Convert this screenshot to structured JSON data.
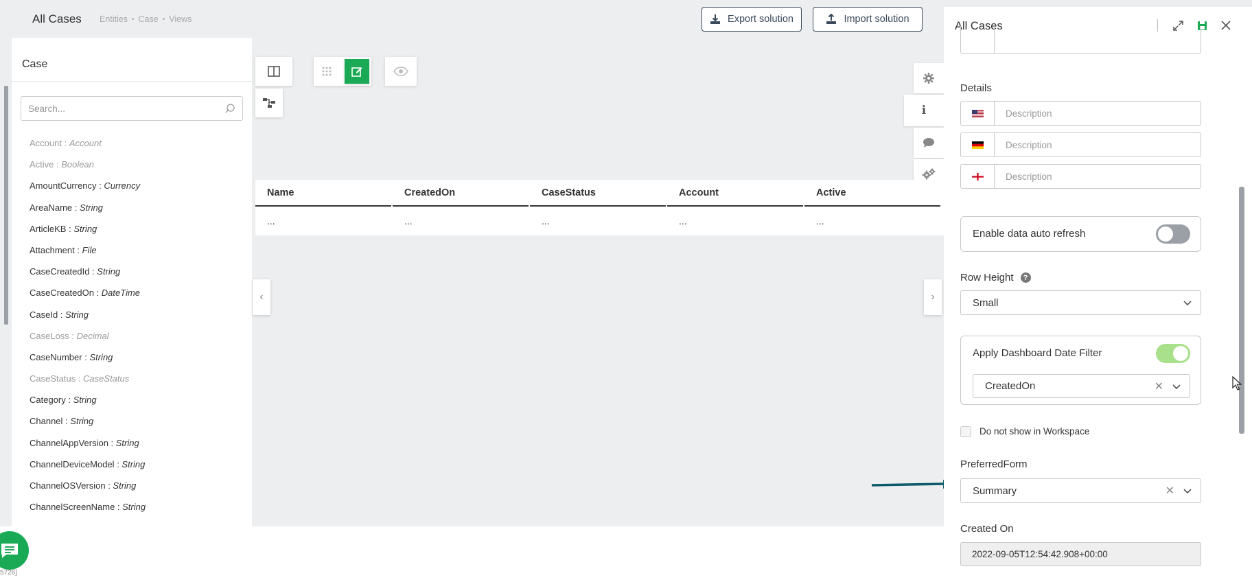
{
  "header": {
    "title": "All Cases",
    "breadcrumb": [
      "Entities",
      "Case",
      "Views"
    ],
    "export_label": "Export solution",
    "import_label": "Import solution"
  },
  "left_panel": {
    "title": "Case",
    "search_placeholder": "Search...",
    "fields": [
      {
        "name": "Account",
        "type": "Account",
        "muted": true
      },
      {
        "name": "Active",
        "type": "Boolean",
        "muted": true
      },
      {
        "name": "AmountCurrency",
        "type": "Currency",
        "muted": false
      },
      {
        "name": "AreaName",
        "type": "String",
        "muted": false
      },
      {
        "name": "ArticleKB",
        "type": "String",
        "muted": false
      },
      {
        "name": "Attachment",
        "type": "File",
        "muted": false
      },
      {
        "name": "CaseCreatedId",
        "type": "String",
        "muted": false
      },
      {
        "name": "CaseCreatedOn",
        "type": "DateTime",
        "muted": false
      },
      {
        "name": "CaseId",
        "type": "String",
        "muted": false
      },
      {
        "name": "CaseLoss",
        "type": "Decimal",
        "muted": true
      },
      {
        "name": "CaseNumber",
        "type": "String",
        "muted": false
      },
      {
        "name": "CaseStatus",
        "type": "CaseStatus",
        "muted": true
      },
      {
        "name": "Category",
        "type": "String",
        "muted": false
      },
      {
        "name": "Channel",
        "type": "String",
        "muted": false
      },
      {
        "name": "ChannelAppVersion",
        "type": "String",
        "muted": false
      },
      {
        "name": "ChannelDeviceModel",
        "type": "String",
        "muted": false
      },
      {
        "name": "ChannelOSVersion",
        "type": "String",
        "muted": false
      },
      {
        "name": "ChannelScreenName",
        "type": "String",
        "muted": false
      }
    ]
  },
  "table": {
    "columns": [
      "Name",
      "CreatedOn",
      "CaseStatus",
      "Account",
      "Active"
    ],
    "row": [
      "...",
      "...",
      "...",
      "...",
      "..."
    ]
  },
  "right_panel": {
    "title": "All Cases",
    "details_label": "Details",
    "description_placeholder": "Description",
    "auto_refresh_label": "Enable data auto refresh",
    "auto_refresh_on": false,
    "row_height_label": "Row Height",
    "row_height_value": "Small",
    "date_filter_label": "Apply Dashboard Date Filter",
    "date_filter_on": true,
    "date_filter_field": "CreatedOn",
    "workspace_label": "Do not show in Workspace",
    "preferred_form_label": "PreferredForm",
    "preferred_form_value": "Summary",
    "created_on_label": "Created On",
    "created_on_value": "2022-09-05T12:54:42.908+00:00"
  },
  "footer": {
    "tiny_text": "5726]"
  },
  "colors": {
    "accent_green": "#1aaa55",
    "arrow_teal": "#0f5a6a",
    "toggle_on": "#a8e08c"
  }
}
